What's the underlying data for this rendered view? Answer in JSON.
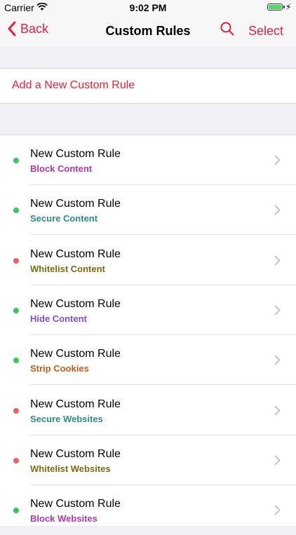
{
  "status_bar": {
    "carrier": "Carrier",
    "time": "9:02 PM",
    "battery_level": 1.0
  },
  "nav": {
    "back_label": "Back",
    "title": "Custom Rules",
    "select_label": "Select",
    "search_icon": "search-icon"
  },
  "add_rule_label": "Add a New Custom Rule",
  "rules": [
    {
      "title": "New Custom Rule",
      "type": "Block Content",
      "type_color": "#b534a8",
      "status_color": "#34c759"
    },
    {
      "title": "New Custom Rule",
      "type": "Secure Content",
      "type_color": "#2c8a82",
      "status_color": "#34c759"
    },
    {
      "title": "New Custom Rule",
      "type": "Whitelist Content",
      "type_color": "#7a6a12",
      "status_color": "#e8625e"
    },
    {
      "title": "New Custom Rule",
      "type": "Hide Content",
      "type_color": "#7e4fc7",
      "status_color": "#34c759"
    },
    {
      "title": "New Custom Rule",
      "type": "Strip Cookies",
      "type_color": "#c05b22",
      "status_color": "#34c759"
    },
    {
      "title": "New Custom Rule",
      "type": "Secure Websites",
      "type_color": "#2c8a82",
      "status_color": "#e8625e"
    },
    {
      "title": "New Custom Rule",
      "type": "Whitelist Websites",
      "type_color": "#7a6a12",
      "status_color": "#e8625e"
    },
    {
      "title": "New Custom Rule",
      "type": "Block Websites",
      "type_color": "#b534a8",
      "status_color": "#34c759"
    }
  ]
}
